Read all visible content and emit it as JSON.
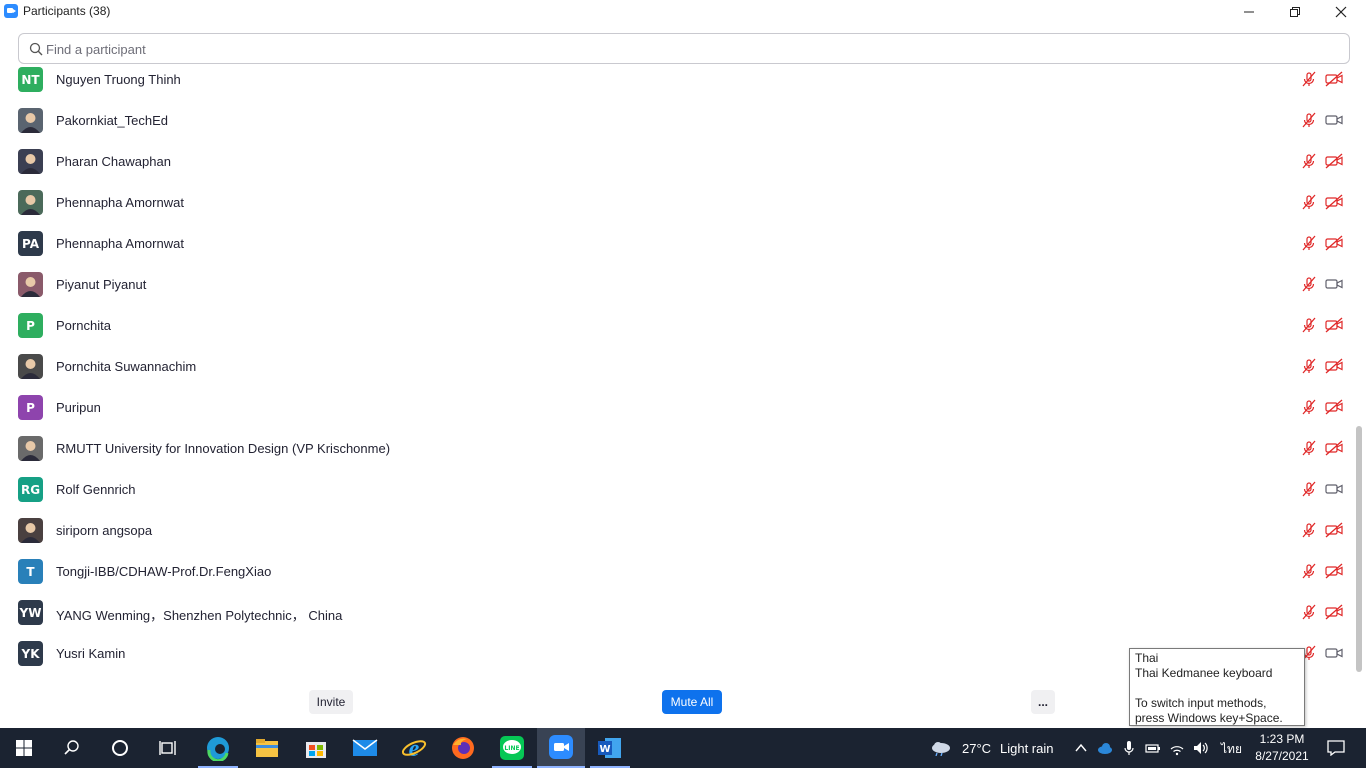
{
  "window": {
    "title": "Participants (38)"
  },
  "search": {
    "placeholder": "Find a participant"
  },
  "participants": [
    {
      "initials": "NT",
      "name": "Nguyen Truong Thinh",
      "avatar_color": "#2eae5f",
      "cam_on": false
    },
    {
      "initials": "",
      "name": "Pakornkiat_TechEd",
      "avatar_color": "#5a6470",
      "cam_on": true
    },
    {
      "initials": "",
      "name": "Pharan Chawaphan",
      "avatar_color": "#3b3f52",
      "cam_on": false
    },
    {
      "initials": "",
      "name": "Phennapha Amornwat",
      "avatar_color": "#4b6a5a",
      "cam_on": false
    },
    {
      "initials": "PA",
      "name": "Phennapha Amornwat",
      "avatar_color": "#2e3a4b",
      "cam_on": false
    },
    {
      "initials": "",
      "name": "Piyanut Piyanut",
      "avatar_color": "#8a5a6a",
      "cam_on": true
    },
    {
      "initials": "P",
      "name": "Pornchita",
      "avatar_color": "#2eae5f",
      "cam_on": false
    },
    {
      "initials": "",
      "name": "Pornchita Suwannachim",
      "avatar_color": "#4a4a4a",
      "cam_on": false
    },
    {
      "initials": "P",
      "name": "Puripun",
      "avatar_color": "#8e44ad",
      "cam_on": false
    },
    {
      "initials": "",
      "name": "RMUTT University for Innovation Design (VP Krischonme)",
      "avatar_color": "#6a6a6a",
      "cam_on": false
    },
    {
      "initials": "RG",
      "name": "Rolf Gennrich",
      "avatar_color": "#16a085",
      "cam_on": true
    },
    {
      "initials": "",
      "name": "siriporn angsopa",
      "avatar_color": "#4a4040",
      "cam_on": false
    },
    {
      "initials": "T",
      "name": "Tongji-IBB/CDHAW-Prof.Dr.FengXiao",
      "avatar_color": "#2980b9",
      "cam_on": false
    },
    {
      "initials": "YW",
      "name": "YANG Wenming，Shenzhen Polytechnic， China",
      "avatar_color": "#2e3a4b",
      "cam_on": false
    },
    {
      "initials": "YK",
      "name": "Yusri Kamin",
      "avatar_color": "#2e3a4b",
      "cam_on": true
    }
  ],
  "buttons": {
    "invite": "Invite",
    "mute_all": "Mute All",
    "more": "..."
  },
  "tooltip": {
    "line1": "Thai",
    "line2": "Thai Kedmanee keyboard",
    "line3": "To switch input methods, press Windows key+Space."
  },
  "taskbar": {
    "weather_temp": "27°C",
    "weather_desc": "Light rain",
    "language": "ไทย",
    "time": "1:23 PM",
    "date": "8/27/2021"
  },
  "colors": {
    "accent": "#0e72ed",
    "muted_red": "#e02828",
    "taskbar": "#1b2331"
  }
}
